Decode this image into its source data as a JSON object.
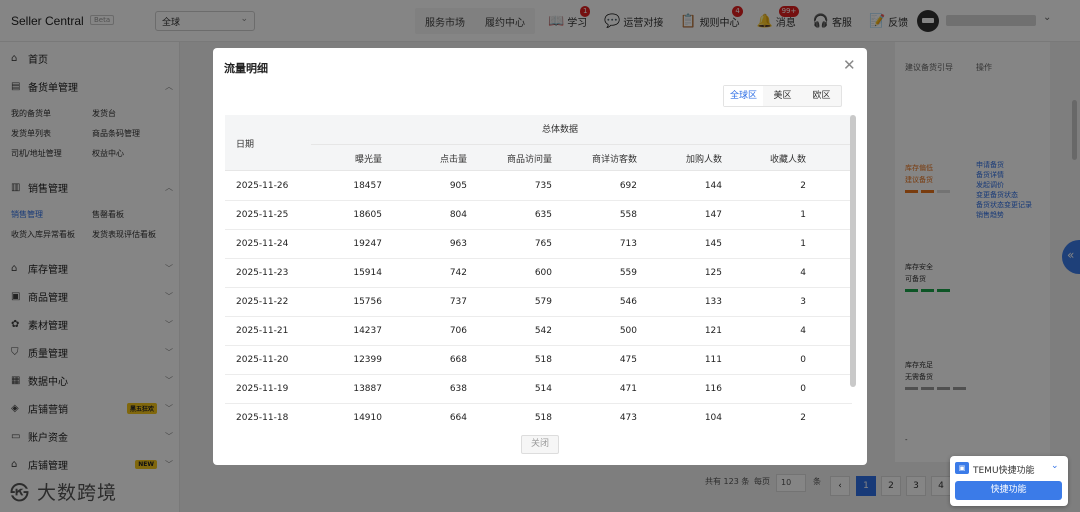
{
  "topbar": {
    "brand": "Seller Central",
    "beta": "Beta",
    "region_select": "全球",
    "links": [
      "服务市场",
      "履约中心"
    ],
    "nav": [
      {
        "label": "学习",
        "icon": "book-icon",
        "badge": "1"
      },
      {
        "label": "运营对接",
        "icon": "chat-icon",
        "badge": ""
      },
      {
        "label": "规则中心",
        "icon": "rules-icon",
        "badge": "4"
      },
      {
        "label": "消息",
        "icon": "bell-icon",
        "badge": "99+"
      },
      {
        "label": "客服",
        "icon": "headset-icon",
        "badge": ""
      },
      {
        "label": "反馈",
        "icon": "feedback-icon",
        "badge": ""
      }
    ]
  },
  "sidebar": {
    "home": "首页",
    "stock_order": "备货单管理",
    "stock_subs": [
      "我的备货单",
      "发货台",
      "发货单列表",
      "商品条码管理",
      "司机/地址管理",
      "权益中心"
    ],
    "sales": "销售管理",
    "sales_subs": [
      "销售管理",
      "售罄看板",
      "收货入库异常看板",
      "发货表现评估看板"
    ],
    "groups": [
      "库存管理",
      "商品管理",
      "素材管理",
      "质量管理",
      "数据中心",
      "店铺营销",
      "账户资金",
      "店铺管理"
    ],
    "tag_marketing": "黑五狂欢",
    "tag_new": "NEW",
    "watermark": "大数跨境"
  },
  "background": {
    "col_head": "建议备货引导",
    "col_op": "操作",
    "rows": [
      {
        "line1": "库存偏低",
        "line2": "建议备货"
      },
      {
        "line1": "库存安全",
        "line2": "可备货"
      },
      {
        "line1": "库存充足",
        "line2": "无需备货"
      }
    ],
    "dash": "-",
    "ops": [
      "申请备货",
      "备货详情",
      "发起调价",
      "变更备货状态",
      "备货状态变更记录",
      "销售趋势"
    ],
    "bar_colors": {
      "orange": "#e8731c",
      "green": "#1aa34a",
      "gray": "#9a9a9a"
    }
  },
  "pagination": {
    "total": "共有 123 条",
    "per_page_label": "每页",
    "per_page": "10",
    "unit": "条",
    "pages": [
      "1",
      "2",
      "3",
      "4"
    ],
    "current": "1"
  },
  "modal": {
    "title": "流量明细",
    "region_tabs": [
      "全球区",
      "美区",
      "欧区"
    ],
    "active_region": "全球区",
    "group_header": "总体数据",
    "date_header": "日期",
    "columns": [
      "曝光量",
      "点击量",
      "商品访问量",
      "商详访客数",
      "加购人数",
      "收藏人数"
    ],
    "rows": [
      [
        "2025-11-26",
        "18457",
        "905",
        "735",
        "692",
        "144",
        "2"
      ],
      [
        "2025-11-25",
        "18605",
        "804",
        "635",
        "558",
        "147",
        "1"
      ],
      [
        "2025-11-24",
        "19247",
        "963",
        "765",
        "713",
        "145",
        "1"
      ],
      [
        "2025-11-23",
        "15914",
        "742",
        "600",
        "559",
        "125",
        "4"
      ],
      [
        "2025-11-22",
        "15756",
        "737",
        "579",
        "546",
        "133",
        "3"
      ],
      [
        "2025-11-21",
        "14237",
        "706",
        "542",
        "500",
        "121",
        "4"
      ],
      [
        "2025-11-20",
        "12399",
        "668",
        "518",
        "475",
        "111",
        "0"
      ],
      [
        "2025-11-19",
        "13887",
        "638",
        "514",
        "471",
        "116",
        "0"
      ],
      [
        "2025-11-18",
        "14910",
        "664",
        "518",
        "473",
        "104",
        "2"
      ]
    ],
    "close_label": "关闭"
  },
  "quick": {
    "title": "TEMU快捷功能",
    "button": "快捷功能"
  },
  "colors": {
    "accent": "#2f6fe6",
    "badge": "#e02020"
  }
}
